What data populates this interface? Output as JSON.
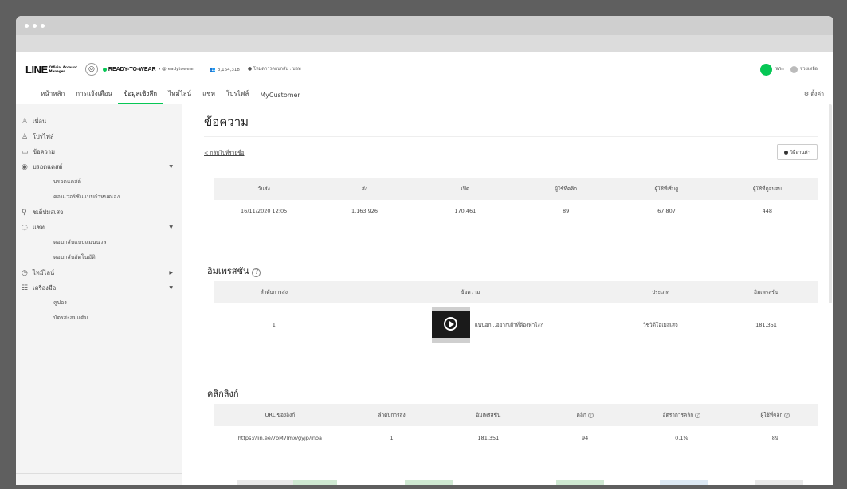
{
  "window": {
    "chrome": "browser"
  },
  "header": {
    "logo_main": "LINE",
    "logo_sub1": "Official Account",
    "logo_sub2": "Manager",
    "account_name": "READY-TO-WEAR",
    "account_id": "@readytowear",
    "friends_count": "3,164,318",
    "chat_mode": "โหมดการตอบกลับ : บอท",
    "user_name": "Win",
    "help_label": "ช่วยเหลือ"
  },
  "nav": {
    "tabs": [
      "หน้าหลัก",
      "การแจ้งเตือน",
      "ข้อมูลเชิงลึก",
      "ไทม์ไลน์",
      "แชท",
      "โปรไฟล์",
      "MyCustomer"
    ],
    "active_index": 2,
    "settings_label": "ตั้งค่า"
  },
  "sidebar": {
    "items": [
      {
        "label": "เพื่อน",
        "icon": "friends-icon"
      },
      {
        "label": "โปรไฟล์",
        "icon": "profile-icon"
      },
      {
        "label": "ข้อความ",
        "icon": "message-icon"
      },
      {
        "label": "บรอดแคสต์",
        "icon": "broadcast-icon",
        "arrow": "▼",
        "children": [
          "บรอดแคสต์",
          "คอนเวอร์ชันแบบกำหนดเอง"
        ]
      },
      {
        "label": "ชเต็ปมสเสจ",
        "icon": "step-icon"
      },
      {
        "label": "แชท",
        "icon": "chat-icon",
        "arrow": "▼",
        "children": [
          "ตอบกลับแบบแมนนวล",
          "ตอบกลับอัตโนมัติ"
        ]
      },
      {
        "label": "ไทม์ไลน์",
        "icon": "timeline-icon",
        "arrow": "▶"
      },
      {
        "label": "เครื่องมือ",
        "icon": "tools-icon",
        "arrow": "▼",
        "children": [
          "คูปอง",
          "บัตรสะสมแต้ม"
        ]
      }
    ]
  },
  "main": {
    "title": "ข้อความ",
    "back_link": "< กลับไปที่รายชื่อ",
    "howto_label": "วิธีอ่านค่า",
    "summary": {
      "headers": [
        "วันส่ง",
        "ส่ง",
        "เปิด",
        "ผู้ใช้ที่คลิก",
        "ผู้ใช้ที่เริ่มดู",
        "ผู้ใช้ที่ดูจนจบ"
      ],
      "row": [
        "16/11/2020 12:05",
        "1,163,926",
        "170,461",
        "89",
        "67,807",
        "448"
      ]
    },
    "impression": {
      "title": "อิมเพรสชัน",
      "headers": [
        "ลำดับการส่ง",
        "ข้อความ",
        "ประเภท",
        "อิมเพรสชัน"
      ],
      "row": [
        "1",
        "แน่นอก...อยากเผ้าที่ต้องทำไง?",
        "วิชวิดีโอเมสเสจ",
        "181,351"
      ]
    },
    "clicks": {
      "title": "คลิกลิงก์",
      "headers": [
        "URL ของลิงก์",
        "ลำดับการส่ง",
        "อิมเพรสชัน",
        "คลิก",
        "อัตราการคลิก",
        "ผู้ใช้ที่คลิก"
      ],
      "row": [
        "https://lin.ee/7oM7lmx/gyjp/inoa",
        "1",
        "181,351",
        "94",
        "0.1%",
        "89"
      ]
    }
  },
  "colors": {
    "accent": "#06c755",
    "header_bg": "#f1f1f1",
    "sidebar_bg": "#f4f4f4"
  }
}
